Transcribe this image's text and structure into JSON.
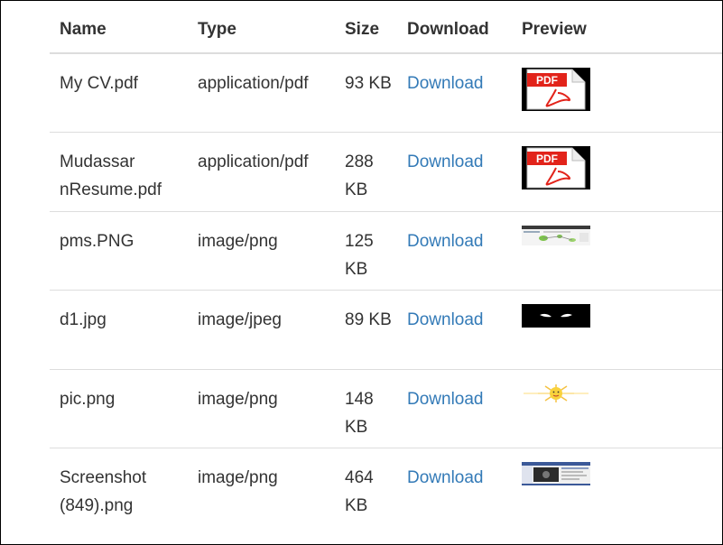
{
  "table": {
    "headers": [
      "Name",
      "Type",
      "Size",
      "Download",
      "Preview"
    ],
    "rows": [
      {
        "name": "My CV.pdf",
        "type": "application/pdf",
        "size": "93 KB",
        "download": "Download",
        "preview": "pdf-thumbnail",
        "preview_label": "PDF"
      },
      {
        "name": "Mudassar nResume.pdf",
        "type": "application/pdf",
        "size": "288 KB",
        "download": "Download",
        "preview": "pdf-thumbnail",
        "preview_label": "PDF"
      },
      {
        "name": "pms.PNG",
        "type": "image/png",
        "size": "125 KB",
        "download": "Download",
        "preview": "webpage-diagram-thumbnail"
      },
      {
        "name": "d1.jpg",
        "type": "image/jpeg",
        "size": "89 KB",
        "download": "Download",
        "preview": "dark-eyes-thumbnail"
      },
      {
        "name": "pic.png",
        "type": "image/png",
        "size": "148 KB",
        "download": "Download",
        "preview": "sun-thumbnail"
      },
      {
        "name": "Screenshot (849).png",
        "type": "image/png",
        "size": "464 KB",
        "download": "Download",
        "preview": "screenshot-thumbnail"
      }
    ]
  },
  "colors": {
    "link": "#337ab7",
    "text": "#333333",
    "border": "#dddddd",
    "pdf_red": "#e2231a"
  }
}
